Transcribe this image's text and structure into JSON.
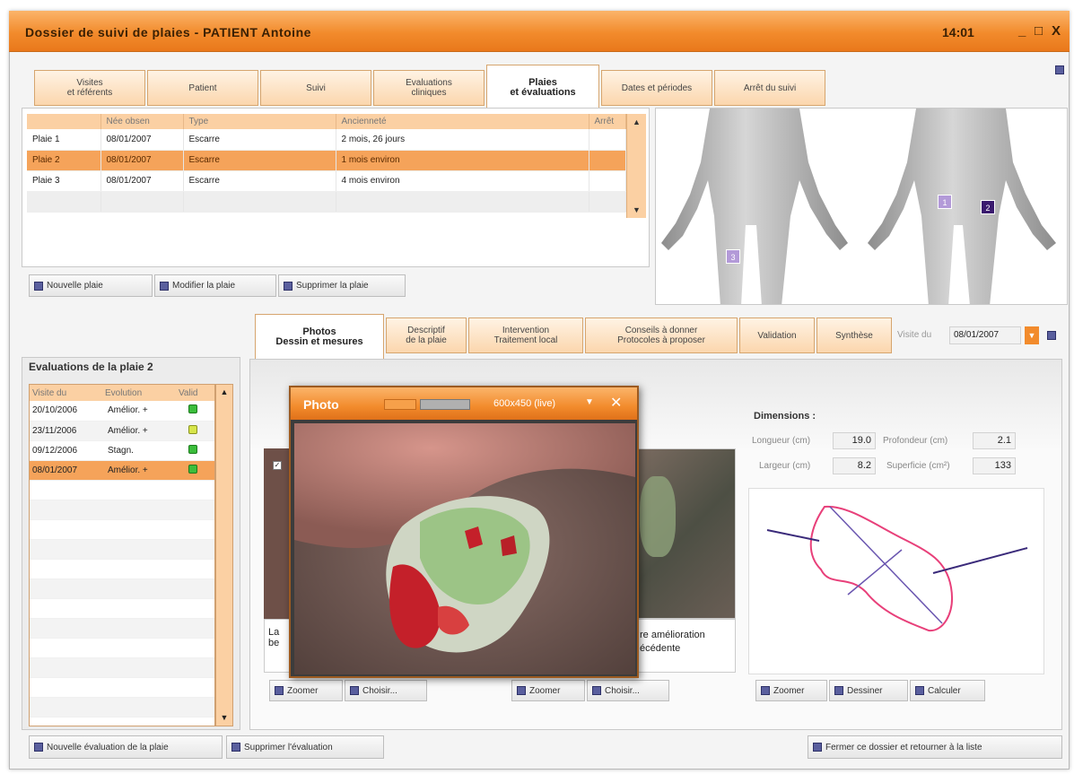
{
  "window": {
    "title": "Dossier de suivi de plaies - PATIENT Antoine",
    "clock": "14:01",
    "controls": [
      "_",
      "□",
      "X"
    ]
  },
  "top_tabs": [
    {
      "l1": "Visites",
      "l2": "et référents"
    },
    {
      "l1": "Patient",
      "l2": ""
    },
    {
      "l1": "Suivi",
      "l2": ""
    },
    {
      "l1": "Evaluations",
      "l2": "cliniques"
    },
    {
      "l1": "Plaies",
      "l2": "et évaluations"
    },
    {
      "l1": "Dates et périodes",
      "l2": ""
    },
    {
      "l1": "Arrêt du suivi",
      "l2": ""
    }
  ],
  "wounds": {
    "headers": [
      "",
      "Née obsen",
      "Type",
      "Ancienneté",
      "Arrêt"
    ],
    "rows": [
      {
        "name": "Plaie 1",
        "date": "08/01/2007",
        "type": "Escarre",
        "age": "2 mois, 26 jours"
      },
      {
        "name": "Plaie 2",
        "date": "08/01/2007",
        "type": "Escarre",
        "age": "1 mois environ"
      },
      {
        "name": "Plaie 3",
        "date": "08/01/2007",
        "type": "Escarre",
        "age": "4 mois environ"
      }
    ]
  },
  "wound_buttons": [
    "Nouvelle plaie",
    "Modifier la plaie",
    "Supprimer la plaie"
  ],
  "body_markers": [
    "3",
    "1",
    "2"
  ],
  "sub_tabs": [
    {
      "l1": "Photos",
      "l2": "Dessin et mesures"
    },
    {
      "l1": "Descriptif",
      "l2": "de la plaie"
    },
    {
      "l1": "Intervention",
      "l2": "Traitement local"
    },
    {
      "l1": "Conseils à donner",
      "l2": "Protocoles à proposer"
    },
    {
      "l1": "Validation",
      "l2": ""
    },
    {
      "l1": "Synthèse",
      "l2": ""
    }
  ],
  "visit_selector": {
    "label": "Visite du",
    "value": "08/01/2007"
  },
  "evaluations": {
    "title": "Evaluations de la plaie 2",
    "headers": [
      "Visite du",
      "Evolution",
      "Valid"
    ],
    "rows": [
      {
        "date": "20/10/2006",
        "evol": "Amélior. +",
        "status": "green"
      },
      {
        "date": "23/11/2006",
        "evol": "Amélior. +",
        "status": "yellow"
      },
      {
        "date": "09/12/2006",
        "evol": "Stagn.",
        "status": "green"
      },
      {
        "date": "08/01/2007",
        "evol": "Amélior. +",
        "status": "green"
      }
    ]
  },
  "eval_buttons": [
    "Nouvelle évaluation de la plaie",
    "Supprimer l'évaluation"
  ],
  "close_button": "Fermer ce dossier et retourner à la liste",
  "photo_popup": {
    "title": "Photo",
    "resolution": "600x450 (live)"
  },
  "photo_captions": {
    "left_1": "La",
    "left_2": "be",
    "right_1": "re amélioration",
    "right_2": "écédente"
  },
  "photo_buttons": [
    "Zoomer",
    "Choisir..."
  ],
  "dimensions": {
    "title": "Dimensions :",
    "length_label": "Longueur (cm)",
    "length": "19.0",
    "depth_label": "Profondeur (cm)",
    "depth": "2.1",
    "width_label": "Largeur (cm)",
    "width": "8.2",
    "area_label": "Superficie (cm²)",
    "area": "133"
  },
  "drawing_buttons": [
    "Zoomer",
    "Dessiner",
    "Calculer"
  ],
  "colors": {
    "accent": "#f28b2c",
    "selection": "#f5a35a",
    "header": "#fbd0a3",
    "marker": "#b39ad8",
    "marker_dark": "#3a1a6e"
  }
}
